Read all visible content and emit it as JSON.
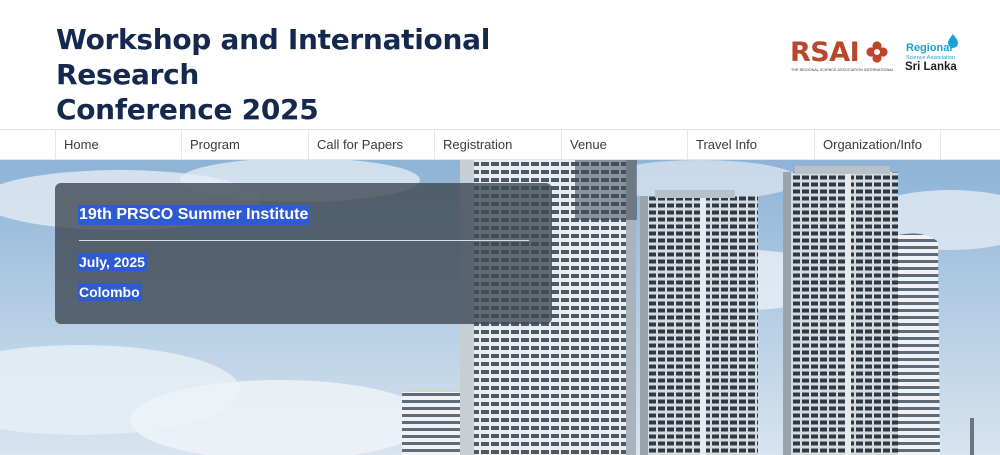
{
  "header": {
    "title_line1": "Workshop and International Research",
    "title_line2": "Conference 2025",
    "title_color": "#15294f"
  },
  "logos": {
    "rsai": {
      "word": "RSAI",
      "subtitle": "THE REGIONAL SCIENCE ASSOCIATION INTERNATIONAL",
      "color": "#b8462b"
    },
    "rsl": {
      "regional": "Regional",
      "science_association": "Science Association",
      "sri_lanka": "Sri Lanka",
      "color": "#1ba0d8"
    }
  },
  "nav": {
    "items": [
      "Home",
      "Program",
      "Call for Papers",
      "Registration",
      "Venue",
      "Travel Info",
      "Organization/Info"
    ]
  },
  "hero": {
    "image": "colombo-skyline-photo",
    "event_title": "19th PRSCO Summer Institute",
    "date": "July, 2025",
    "place": "Colombo",
    "highlight_color": "#2f5bd0"
  }
}
